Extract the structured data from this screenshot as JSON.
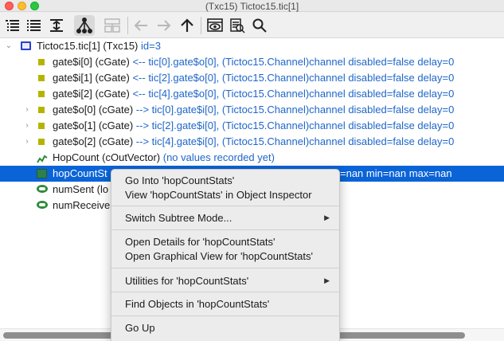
{
  "window": {
    "title": "(Txc15) Tictoc15.tic[1]"
  },
  "toolbar": {
    "buttons": [
      {
        "name": "children-mode-icon"
      },
      {
        "name": "flat-mode-icon"
      },
      {
        "name": "grouped-mode-icon"
      },
      {
        "name": "inheritance-mode-icon"
      },
      {
        "name": "grid-mode-icon"
      },
      {
        "name": "back-icon"
      },
      {
        "name": "forward-icon"
      },
      {
        "name": "up-icon"
      },
      {
        "name": "inspect-icon"
      },
      {
        "name": "find-objects-icon"
      },
      {
        "name": "search-icon"
      }
    ]
  },
  "tree": {
    "root": {
      "name": "Tictoc15.tic[1] (Txc15)",
      "info": "id=3"
    },
    "gates": [
      {
        "name": "gate$i[0] (cGate)",
        "info": "<-- tic[0].gate$o[0], (Tictoc15.Channel)channel disabled=false delay=0"
      },
      {
        "name": "gate$i[1] (cGate)",
        "info": "<-- tic[2].gate$o[0], (Tictoc15.Channel)channel disabled=false delay=0"
      },
      {
        "name": "gate$i[2] (cGate)",
        "info": "<-- tic[4].gate$o[0], (Tictoc15.Channel)channel disabled=false delay=0"
      },
      {
        "name": "gate$o[0] (cGate)",
        "info": "--> tic[0].gate$i[0], (Tictoc15.Channel)channel disabled=false delay=0"
      },
      {
        "name": "gate$o[1] (cGate)",
        "info": "--> tic[2].gate$i[0], (Tictoc15.Channel)channel disabled=false delay=0"
      },
      {
        "name": "gate$o[2] (cGate)",
        "info": "--> tic[4].gate$i[0], (Tictoc15.Channel)channel disabled=false delay=0"
      }
    ],
    "hopCount": {
      "name": "HopCount (cOutVector)",
      "info": "(no values recorded yet)"
    },
    "hopCountStats": {
      "name": "hopCountSt",
      "info": "=nan min=nan max=nan"
    },
    "numSent": {
      "name": "numSent (lo"
    },
    "numReceived": {
      "name": "numReceive"
    }
  },
  "context_menu": {
    "go_into": "Go Into 'hopCountStats'",
    "view_in_inspector": "View 'hopCountStats' in Object Inspector",
    "switch_subtree": "Switch Subtree Mode...",
    "open_details": "Open Details for 'hopCountStats'",
    "open_graphical": "Open Graphical View for 'hopCountStats'",
    "utilities": "Utilities for 'hopCountStats'",
    "find_objects": "Find Objects in 'hopCountStats'",
    "go_up": "Go Up",
    "submenu_arrow": "▶"
  },
  "colors": {
    "selection": "#0a64d8",
    "info_text": "#1f66c8",
    "gate_icon": "#b4b400"
  }
}
